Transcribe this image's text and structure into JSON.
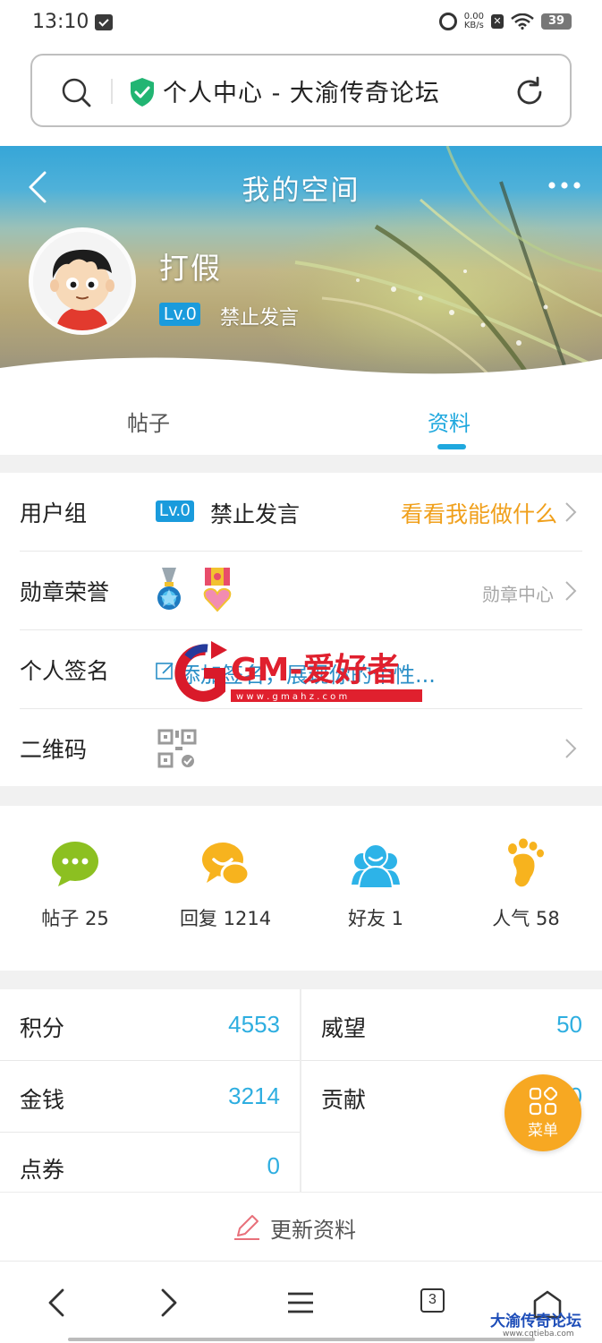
{
  "status_bar": {
    "time": "13:10",
    "speed_top": "0.00",
    "speed_unit": "KB/s",
    "battery": "39"
  },
  "url_bar": {
    "title": "个人中心 - 大渝传奇论坛"
  },
  "header": {
    "title": "我的空间"
  },
  "profile": {
    "name": "打假",
    "level": "Lv.0",
    "status": "禁止发言"
  },
  "tabs": [
    {
      "label": "帖子"
    },
    {
      "label": "资料"
    }
  ],
  "info": {
    "user_group": {
      "label": "用户组",
      "level": "Lv.0",
      "status": "禁止发言",
      "link": "看看我能做什么"
    },
    "medals": {
      "label": "勋章荣誉",
      "link": "勋章中心"
    },
    "signature": {
      "label": "个人签名",
      "placeholder": "添加签名，展现你的个性..."
    },
    "qrcode": {
      "label": "二维码"
    }
  },
  "watermark": {
    "text": "GM-爱好者",
    "url": "w w w . g m a h z . c o m"
  },
  "stats": [
    {
      "label": "帖子 25",
      "icon": "chat-bubble-icon",
      "color": "#8cc021"
    },
    {
      "label": "回复 1214",
      "icon": "reply-bubbles-icon",
      "color": "#f7b31e"
    },
    {
      "label": "好友 1",
      "icon": "friends-icon",
      "color": "#2db3e8"
    },
    {
      "label": "人气 58",
      "icon": "footprint-icon",
      "color": "#f7b31e"
    }
  ],
  "scores": {
    "jifen": {
      "label": "积分",
      "value": "4553"
    },
    "weiwang": {
      "label": "威望",
      "value": "50"
    },
    "jinqian": {
      "label": "金钱",
      "value": "3214"
    },
    "gongxian": {
      "label": "贡献",
      "value": "0"
    },
    "dianquan": {
      "label": "点券",
      "value": "0"
    }
  },
  "fab": {
    "label": "菜单"
  },
  "update": {
    "label": "更新资料"
  },
  "browser_nav": {
    "tab_count": "3"
  },
  "corner_brand": {
    "name": "大渝传奇论坛",
    "url": "www.cqtieba.com"
  },
  "colors": {
    "accent": "#1fa8de",
    "orange": "#f0a01c",
    "level_badge": "#1a9bdc",
    "fab": "#f7a822"
  }
}
